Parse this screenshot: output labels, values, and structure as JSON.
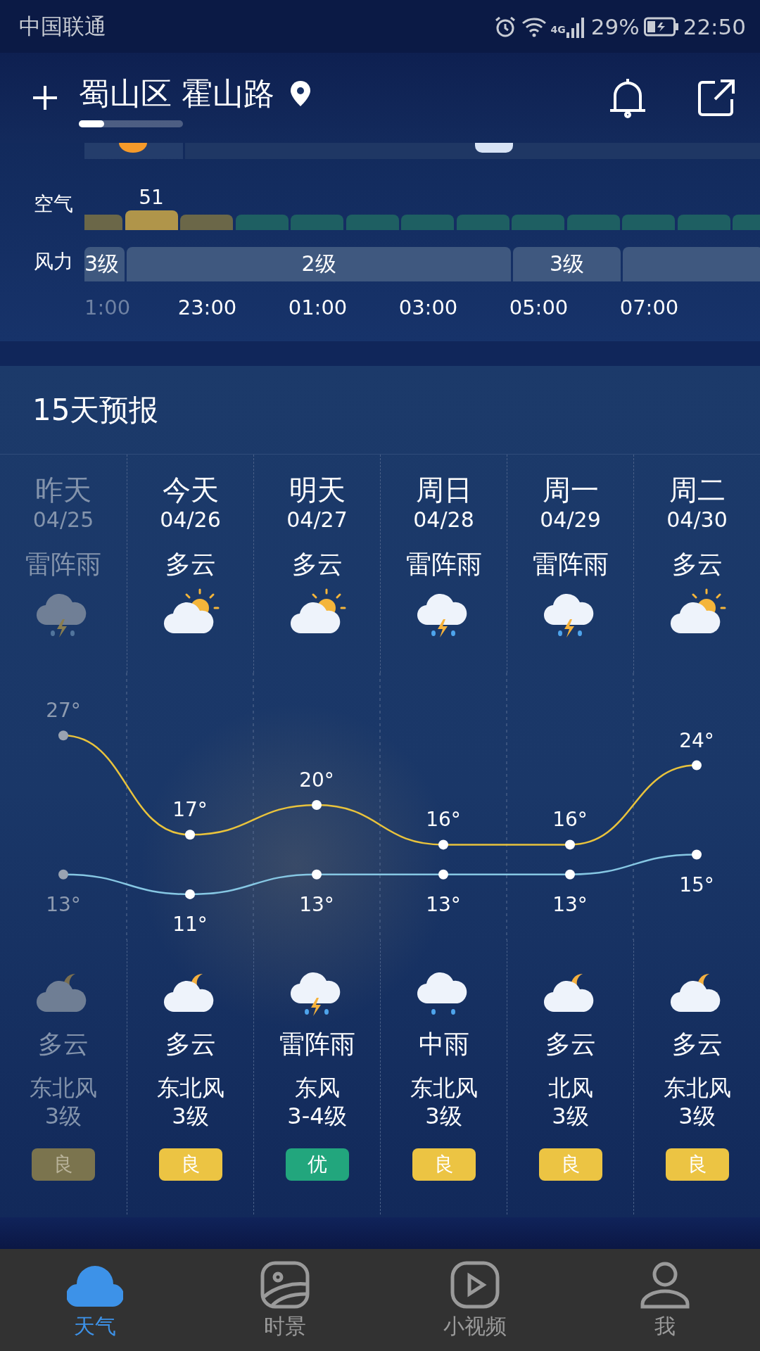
{
  "status_bar": {
    "carrier": "中国联通",
    "network": "4G",
    "battery": "29%",
    "time": "22:50"
  },
  "header": {
    "location": "蜀山区 霍山路"
  },
  "hourly": {
    "air_label": "空气",
    "wind_label": "风力",
    "air": [
      {
        "color": "#6b6748",
        "selected": false
      },
      {
        "color": "#b0954a",
        "selected": true,
        "value": "51"
      },
      {
        "color": "#6b6748",
        "selected": false
      },
      {
        "color": "#1e5f62",
        "selected": false
      },
      {
        "color": "#1e5f62",
        "selected": false
      },
      {
        "color": "#1e5f62",
        "selected": false
      },
      {
        "color": "#1e5f62",
        "selected": false
      },
      {
        "color": "#1e5f62",
        "selected": false
      },
      {
        "color": "#1e5f62",
        "selected": false
      },
      {
        "color": "#1e5f62",
        "selected": false
      },
      {
        "color": "#1e5f62",
        "selected": false
      },
      {
        "color": "#1e5f62",
        "selected": false
      },
      {
        "color": "#1e5f62",
        "selected": false
      }
    ],
    "wind": [
      {
        "label": "3级"
      },
      {
        "label": "2级"
      },
      {
        "label": "3级"
      }
    ],
    "times": [
      {
        "label": "1:00",
        "past": true
      },
      {
        "label": "23:00",
        "past": false
      },
      {
        "label": "01:00",
        "past": false
      },
      {
        "label": "03:00",
        "past": false
      },
      {
        "label": "05:00",
        "past": false
      },
      {
        "label": "07:00",
        "past": false
      }
    ]
  },
  "forecast": {
    "title": "15天预报",
    "days": [
      {
        "day": "昨天",
        "date": "04/25",
        "past": true,
        "daytime": {
          "condition": "雷阵雨",
          "kind": "thunderstorm"
        },
        "night": {
          "kind": "night_cloudy",
          "condition": "多云"
        },
        "wind_dir": "东北风",
        "wind_level": "3级",
        "aqi": {
          "label": "良",
          "color": "#7b744e"
        }
      },
      {
        "day": "今天",
        "date": "04/26",
        "past": false,
        "daytime": {
          "condition": "多云",
          "kind": "partly_cloudy"
        },
        "night": {
          "kind": "night_cloudy",
          "condition": "多云"
        },
        "wind_dir": "东北风",
        "wind_level": "3级",
        "aqi": {
          "label": "良",
          "color": "#ecc443"
        }
      },
      {
        "day": "明天",
        "date": "04/27",
        "past": false,
        "daytime": {
          "condition": "多云",
          "kind": "partly_cloudy"
        },
        "night": {
          "kind": "thunderstorm",
          "condition": "雷阵雨"
        },
        "wind_dir": "东风",
        "wind_level": "3-4级",
        "aqi": {
          "label": "优",
          "color": "#22a67d"
        }
      },
      {
        "day": "周日",
        "date": "04/28",
        "past": false,
        "daytime": {
          "condition": "雷阵雨",
          "kind": "thunderstorm"
        },
        "night": {
          "kind": "rain",
          "condition": "中雨"
        },
        "wind_dir": "东北风",
        "wind_level": "3级",
        "aqi": {
          "label": "良",
          "color": "#ecc443"
        }
      },
      {
        "day": "周一",
        "date": "04/29",
        "past": false,
        "daytime": {
          "condition": "雷阵雨",
          "kind": "thunderstorm"
        },
        "night": {
          "kind": "night_cloudy",
          "condition": "多云"
        },
        "wind_dir": "北风",
        "wind_level": "3级",
        "aqi": {
          "label": "良",
          "color": "#ecc443"
        }
      },
      {
        "day": "周二",
        "date": "04/30",
        "past": false,
        "daytime": {
          "condition": "多云",
          "kind": "partly_cloudy"
        },
        "night": {
          "kind": "night_cloudy",
          "condition": "多云"
        },
        "wind_dir": "东北风",
        "wind_level": "3级",
        "aqi": {
          "label": "良",
          "color": "#ecc443"
        }
      }
    ],
    "chart_data": {
      "type": "line",
      "series": [
        {
          "color": "#e9c33c",
          "marker": "circle",
          "values": [
            27,
            17,
            20,
            16,
            16,
            24
          ],
          "value_labels": [
            "27°",
            "17°",
            "20°",
            "16°",
            "16°",
            "24°"
          ]
        },
        {
          "color": "#86c7e3",
          "marker": "circle",
          "values": [
            13,
            11,
            13,
            13,
            13,
            15
          ],
          "value_labels": [
            "13°",
            "11°",
            "13°",
            "13°",
            "13°",
            "15°"
          ]
        }
      ],
      "data_labels": true
    }
  },
  "nav": [
    {
      "label": "天气",
      "kind": "weather",
      "selected": true
    },
    {
      "label": "时景",
      "kind": "scenery",
      "selected": false
    },
    {
      "label": "小视频",
      "kind": "video",
      "selected": false
    },
    {
      "label": "我",
      "kind": "profile",
      "selected": false
    }
  ]
}
